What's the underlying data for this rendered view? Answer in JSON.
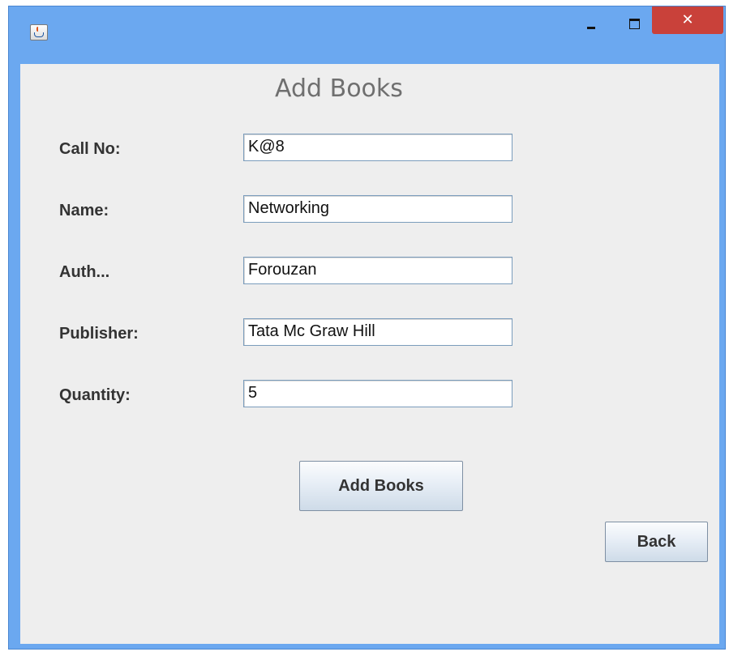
{
  "window": {
    "title": "",
    "close_glyph": "✕"
  },
  "form": {
    "heading": "Add Books",
    "fields": [
      {
        "label": "Call No:",
        "value": "K@8"
      },
      {
        "label": "Name:",
        "value": "Networking"
      },
      {
        "label": "Auth...",
        "value": "Forouzan"
      },
      {
        "label": "Publisher:",
        "value": "Tata Mc Graw Hill"
      },
      {
        "label": "Quantity:",
        "value": "5"
      }
    ],
    "add_button_label": "Add Books",
    "back_button_label": "Back"
  },
  "icons": [
    "java-app-icon",
    "minimize-icon",
    "maximize-icon",
    "close-icon"
  ],
  "colors": {
    "titlebar": "#6ba8f0",
    "close_button": "#c9413a",
    "client_background": "#eeeeee"
  }
}
